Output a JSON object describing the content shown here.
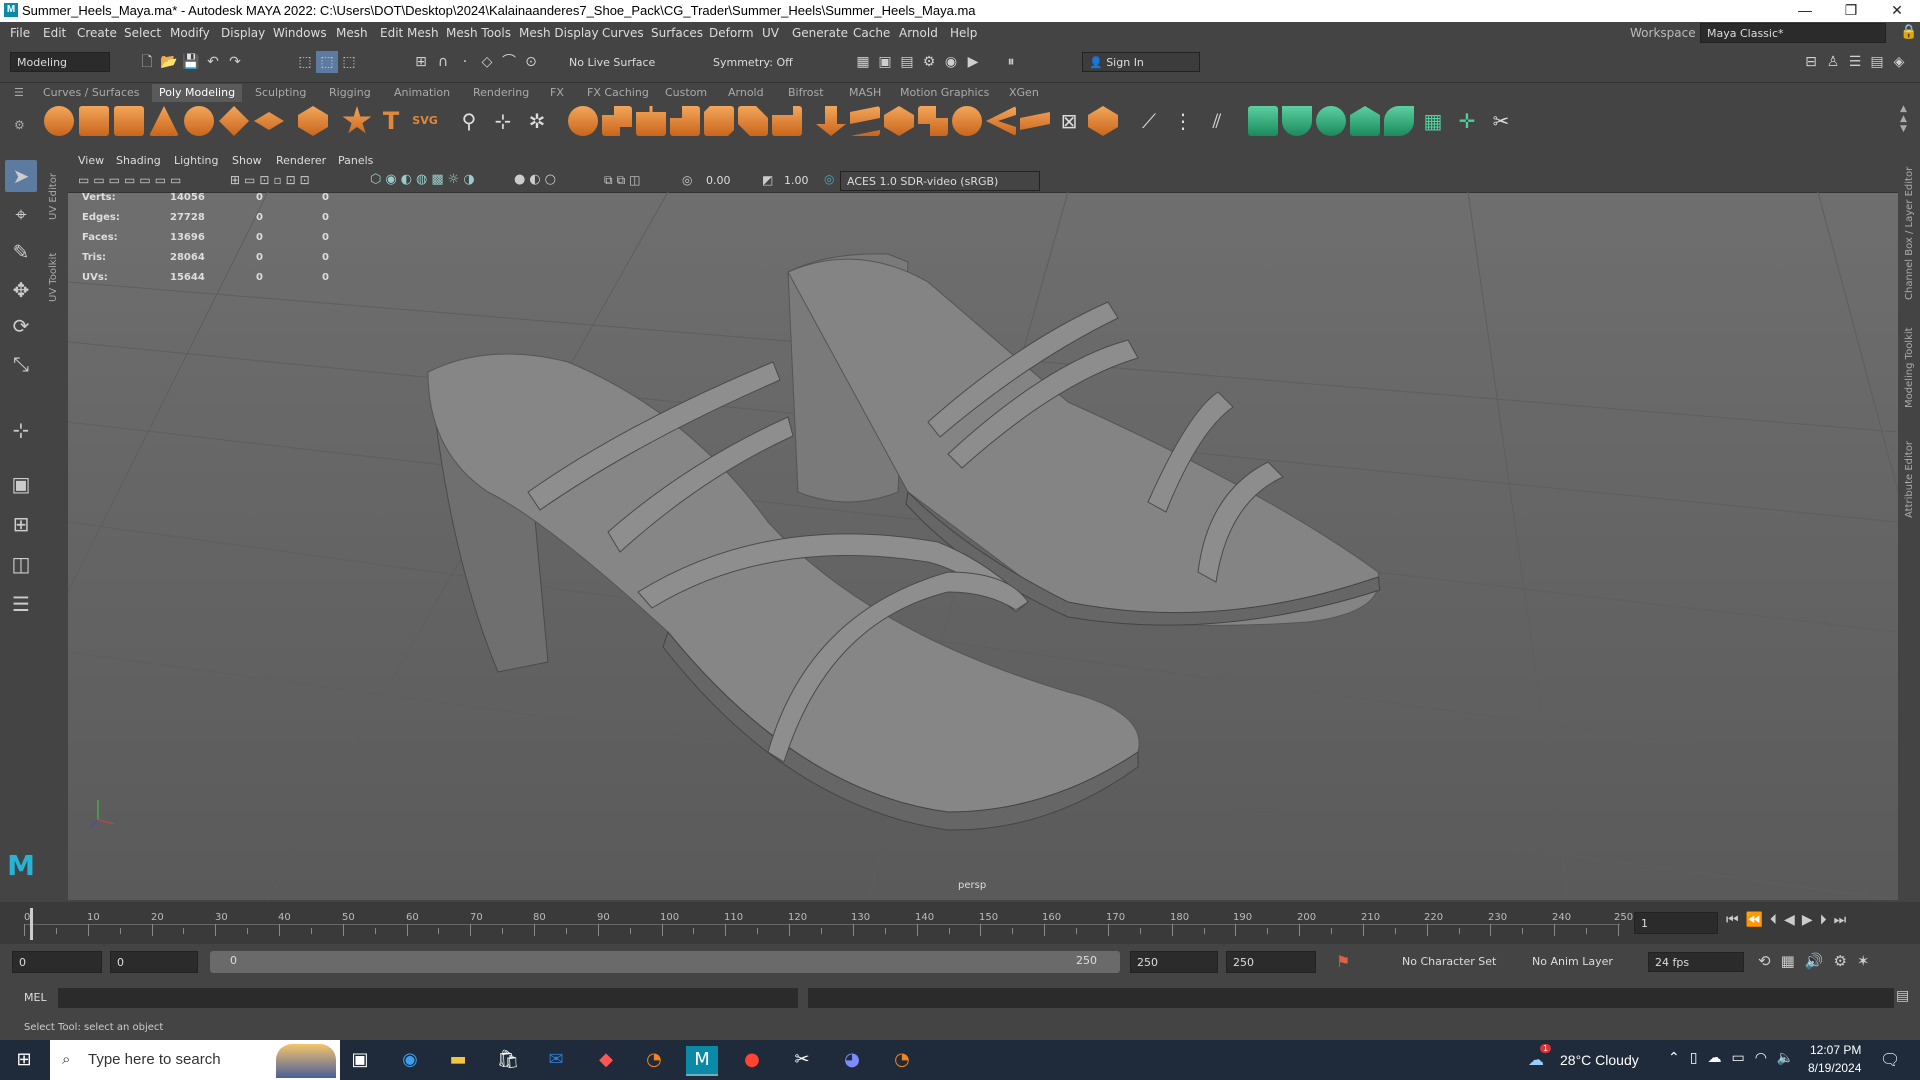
{
  "window": {
    "title": "Summer_Heels_Maya.ma* - Autodesk MAYA 2022: C:\\Users\\DOT\\Desktop\\2024\\Kalainaanderes7_Shoe_Pack\\CG_Trader\\Summer_Heels\\Summer_Heels_Maya.ma",
    "minimize": "—",
    "restore": "❐",
    "close": "✕"
  },
  "menubar": {
    "items": [
      "File",
      "Edit",
      "Create",
      "Select",
      "Modify",
      "Display",
      "Windows",
      "Mesh",
      "Edit Mesh",
      "Mesh Tools",
      "Mesh Display",
      "Curves",
      "Surfaces",
      "Deform",
      "UV",
      "Generate",
      "Cache",
      "Arnold",
      "Help"
    ],
    "workspace_label": "Workspace :",
    "workspace_value": "Maya Classic*"
  },
  "statusline": {
    "mode": "Modeling",
    "live_surface": "No Live Surface",
    "symmetry": "Symmetry: Off",
    "sign_in": "Sign In"
  },
  "shelf": {
    "tabs": [
      "Curves / Surfaces",
      "Poly Modeling",
      "Sculpting",
      "Rigging",
      "Animation",
      "Rendering",
      "FX",
      "FX Caching",
      "Custom",
      "Arnold",
      "Bifrost",
      "MASH",
      "Motion Graphics",
      "XGen"
    ],
    "active_tab": "Poly Modeling",
    "text_icon": "T",
    "svg_icon": "SVG"
  },
  "side_panels": {
    "left": [
      "UV Editor",
      "UV Toolkit"
    ],
    "right": [
      "Channel Box / Layer Editor",
      "Modeling Toolkit",
      "Attribute Editor"
    ]
  },
  "viewport": {
    "menu": [
      "View",
      "Shading",
      "Lighting",
      "Show",
      "Renderer",
      "Panels"
    ],
    "exposure": "0.00",
    "gamma": "1.00",
    "color_space": "ACES 1.0 SDR-video (sRGB)",
    "camera": "persp",
    "hud": [
      {
        "label": "Verts:",
        "a": "14056",
        "b": "0",
        "c": "0"
      },
      {
        "label": "Edges:",
        "a": "27728",
        "b": "0",
        "c": "0"
      },
      {
        "label": "Faces:",
        "a": "13696",
        "b": "0",
        "c": "0"
      },
      {
        "label": "Tris:",
        "a": "28064",
        "b": "0",
        "c": "0"
      },
      {
        "label": "UVs:",
        "a": "15644",
        "b": "0",
        "c": "0"
      }
    ]
  },
  "timeline": {
    "labels": [
      "0",
      "10",
      "20",
      "30",
      "40",
      "50",
      "60",
      "70",
      "80",
      "90",
      "100",
      "110",
      "120",
      "130",
      "140",
      "150",
      "160",
      "170",
      "180",
      "190",
      "200",
      "210",
      "220",
      "230",
      "240",
      "250"
    ],
    "current_frame": "1"
  },
  "range": {
    "start": "0",
    "playback_start": "0",
    "slider_start": "0",
    "slider_end": "250",
    "playback_end": "250",
    "end": "250",
    "character_set": "No Character Set",
    "anim_layer": "No Anim Layer",
    "fps": "24 fps"
  },
  "cmdline": {
    "label": "MEL",
    "help": "Select Tool: select an object"
  },
  "taskbar": {
    "search_placeholder": "Type here to search",
    "weather": "28°C  Cloudy",
    "time": "12:07 PM",
    "date": "8/19/2024",
    "notification_count": "1"
  },
  "colors": {
    "maya_bg": "#444444",
    "viewport_top": "#707070",
    "shelf_orange": "#e0893a",
    "shelf_teal": "#2fa874",
    "accent": "#5d7aa0"
  }
}
